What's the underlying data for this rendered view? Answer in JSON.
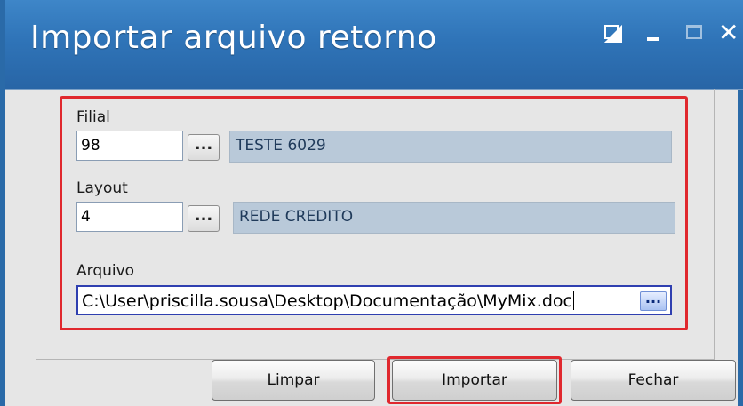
{
  "window": {
    "title": "Importar arquivo retorno",
    "close_glyph": "✕"
  },
  "form": {
    "filial": {
      "label": "Filial",
      "code": "98",
      "lookup": "...",
      "description": "TESTE 6029"
    },
    "layout": {
      "label": "Layout",
      "code": "4",
      "lookup": "...",
      "description": "REDE CREDITO"
    },
    "arquivo": {
      "label": "Arquivo",
      "path": "C:\\User\\priscilla.sousa\\Desktop\\Documentação\\MyMix.doc",
      "browse": "..."
    }
  },
  "buttons": {
    "limpar": {
      "first": "L",
      "rest": "impar"
    },
    "importar": {
      "first": "I",
      "rest": "mportar"
    },
    "fechar": {
      "first": "F",
      "rest": "echar"
    }
  },
  "colors": {
    "titlebar": "#2f74b8",
    "highlight": "#e0282e",
    "readonly_field": "#b9c9d9"
  }
}
